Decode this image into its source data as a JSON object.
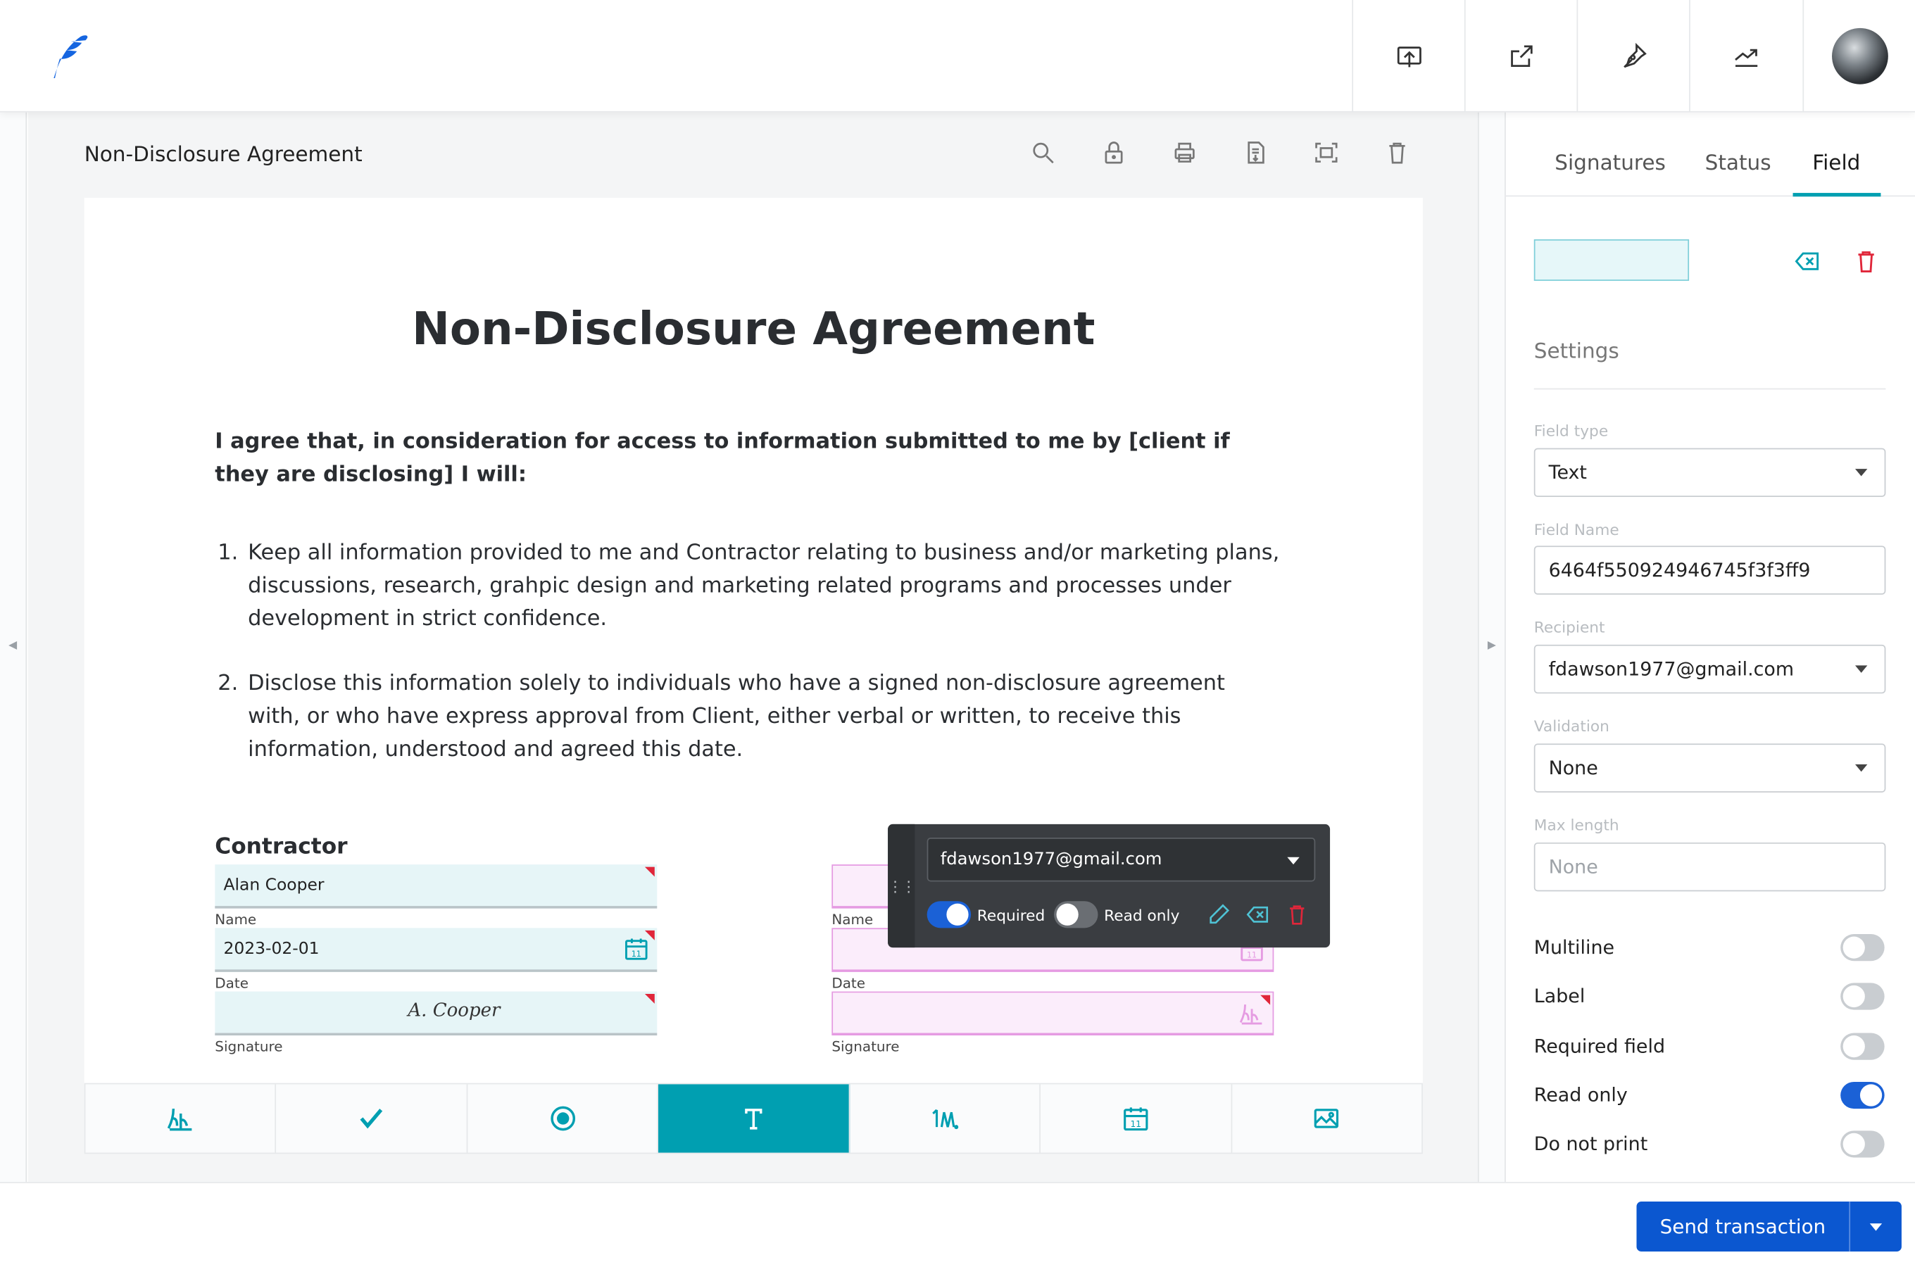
{
  "colors": {
    "accent": "#009fb1",
    "brand": "#0b57d0",
    "toggle_on": "#1b61d6",
    "danger": "#e0263a",
    "pink_field": "#e59be2"
  },
  "topbar": {
    "logo": "feather-logo-icon",
    "actions": [
      "upload-icon",
      "share-icon",
      "pen-nib-icon",
      "trend-chart-icon"
    ],
    "avatar": "user-avatar"
  },
  "document": {
    "name": "Non-Disclosure Agreement",
    "tools": [
      "search-icon",
      "lock-icon",
      "print-icon",
      "document-download-icon",
      "fit-screen-icon",
      "trash-icon"
    ],
    "heading": "Non-Disclosure Agreement",
    "intro": "I agree that, in consideration for access to information submitted to me by [client if they are disclosing] I will:",
    "items": [
      {
        "num": "1.",
        "text": "Keep all information provided to me and Contractor relating to business and/or marketing plans, discussions, research, grahpic design and marketing related programs and processes under development in strict confidence."
      },
      {
        "num": "2.",
        "text": "Disclose this information solely to individuals who have a signed non-disclosure agreement with, or who have express approval from Client, either verbal or written, to receive this information, understood and agreed this date."
      }
    ],
    "contractor_heading": "Contractor",
    "contractor_fields": {
      "name_value": "Alan Cooper",
      "name_label": "Name",
      "date_value": "2023-02-01",
      "date_label": "Date",
      "signature_value": "A. Cooper",
      "signature_label": "Signature"
    },
    "client_fields": {
      "name_label": "Name",
      "date_label": "Date",
      "signature_label": "Signature"
    }
  },
  "popup": {
    "recipient": "fdawson1977@gmail.com",
    "required_label": "Required",
    "required_on": true,
    "readonly_label": "Read only",
    "readonly_on": false,
    "icons": [
      "pencil-icon",
      "clear-field-icon",
      "trash-icon"
    ]
  },
  "field_toolbar": {
    "tools": [
      "signature-tool-icon",
      "checkbox-tool-icon",
      "radio-tool-icon",
      "text-tool-icon",
      "initials-tool-icon",
      "date-tool-icon",
      "image-tool-icon"
    ],
    "active": "text-tool-icon"
  },
  "sidebar": {
    "tabs": [
      "Signatures",
      "Status",
      "Field"
    ],
    "active_tab": "Field",
    "settings_heading": "Settings",
    "field_type_label": "Field type",
    "field_type_value": "Text",
    "field_name_label": "Field Name",
    "field_name_value": "6464f550924946745f3f3ff9",
    "recipient_label": "Recipient",
    "recipient_value": "fdawson1977@gmail.com",
    "validation_label": "Validation",
    "validation_value": "None",
    "max_length_label": "Max length",
    "max_length_placeholder": "None",
    "options": [
      {
        "label": "Multiline",
        "on": false
      },
      {
        "label": "Label",
        "on": false
      },
      {
        "label": "Required field",
        "on": false
      },
      {
        "label": "Read only",
        "on": true
      },
      {
        "label": "Do not print",
        "on": false
      }
    ]
  },
  "footer": {
    "send_label": "Send transaction"
  }
}
